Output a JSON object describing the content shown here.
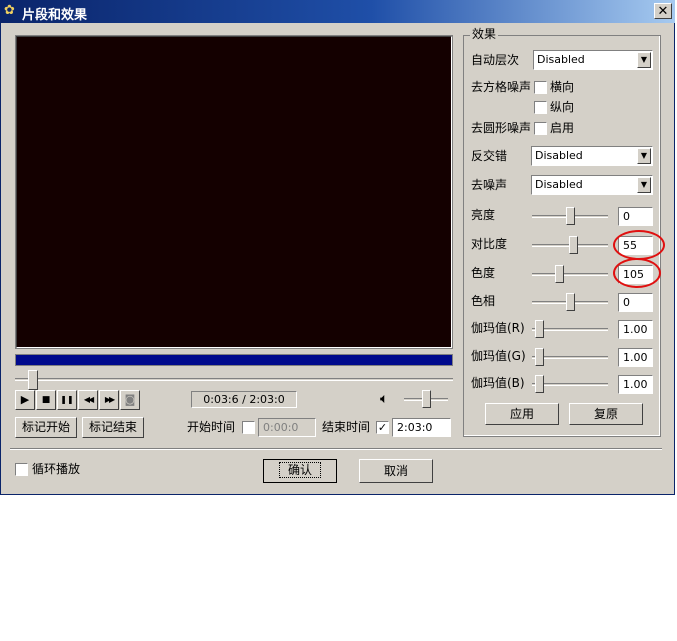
{
  "window": {
    "title": "片段和效果",
    "close": "✕"
  },
  "player": {
    "time_display": "0:03:6 / 2:03:0",
    "controls": {
      "play": "▶",
      "stop": "■",
      "pause": "❚❚",
      "rewind": "◀◀",
      "forward": "▶▶"
    },
    "mark_start": "标记开始",
    "mark_end": "标记结束",
    "start_time_label": "开始时间",
    "start_time_value": "0:00:0",
    "start_time_checked": false,
    "end_time_label": "结束时间",
    "end_time_value": "2:03:0",
    "end_time_checked": true,
    "progress_fraction": 1.0,
    "seek_position": 0.03,
    "volume_level": 0.5
  },
  "effects": {
    "group_title": "效果",
    "auto_level_label": "自动层次",
    "auto_level_value": "Disabled",
    "deblock_label": "去方格噪声",
    "deblock_horizontal": "横向",
    "deblock_vertical": "纵向",
    "dering_label": "去圆形噪声",
    "dering_enable": "启用",
    "deinterlace_label": "反交错",
    "deinterlace_value": "Disabled",
    "denoise_label": "去噪声",
    "denoise_value": "Disabled",
    "sliders": [
      {
        "label": "亮度",
        "value": "0",
        "level": 0.5
      },
      {
        "label": "对比度",
        "value": "55",
        "level": 0.55
      },
      {
        "label": "色度",
        "value": "105",
        "level": 0.35
      },
      {
        "label": "色相",
        "value": "0",
        "level": 0.5
      },
      {
        "label": "伽玛值(R)",
        "value": "1.00",
        "level": 0.05
      },
      {
        "label": "伽玛值(G)",
        "value": "1.00",
        "level": 0.05
      },
      {
        "label": "伽玛值(B)",
        "value": "1.00",
        "level": 0.05
      }
    ],
    "apply": "应用",
    "reset": "复原"
  },
  "footer": {
    "loop_label": "循环播放",
    "loop_checked": false,
    "ok": "确认",
    "cancel": "取消"
  },
  "colors": {
    "annotation": "#e01010",
    "video_bg": "#140000",
    "progress": "#000a8c"
  }
}
